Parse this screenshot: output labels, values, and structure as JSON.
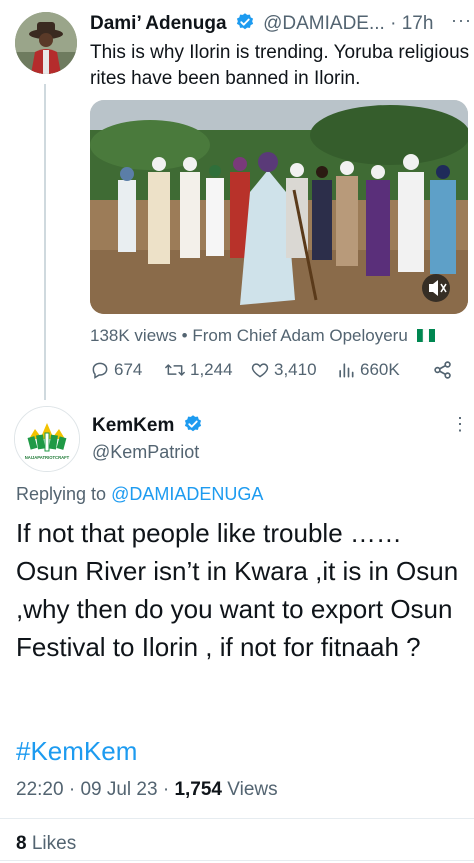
{
  "tweet1": {
    "name": "Dami’ Adenuga",
    "handle": "@DAMIADE...",
    "separator": "·",
    "time": "17h",
    "more": "···",
    "text": "This is why Ilorin is trending. Yoruba religious rites have been banned in Ilorin.",
    "views": "138K views",
    "bullet": "•",
    "source": "From Chief Adam Opeloyeru",
    "replies": "674",
    "retweets": "1,244",
    "likes": "3,410",
    "analytics": "660K"
  },
  "tweet2": {
    "name": "KemKem",
    "handle": "@KemPatriot",
    "more": "⋮",
    "reply_prefix": "Replying to",
    "reply_to": "@DAMIADENUGA",
    "text": "If not that people like trouble …… Osun River isn’t in Kwara ,it is in Osun ,why then do you want to export Osun Festival to Ilorin , if not for fitnaah ?",
    "hashtag": "#KemKem",
    "time": "22:20",
    "sep1": "·",
    "date": "09 Jul 23",
    "sep2": "·",
    "views_count": "1,754",
    "views_label": "Views",
    "likes_count": "8",
    "likes_label": "Likes",
    "avatar_text": "NAIJAPATRIOTCRAFT"
  },
  "colors": {
    "accent": "#1d9bf0",
    "secondary_text": "#536471",
    "primary_text": "#0f1419",
    "flag_green": "#008751"
  }
}
